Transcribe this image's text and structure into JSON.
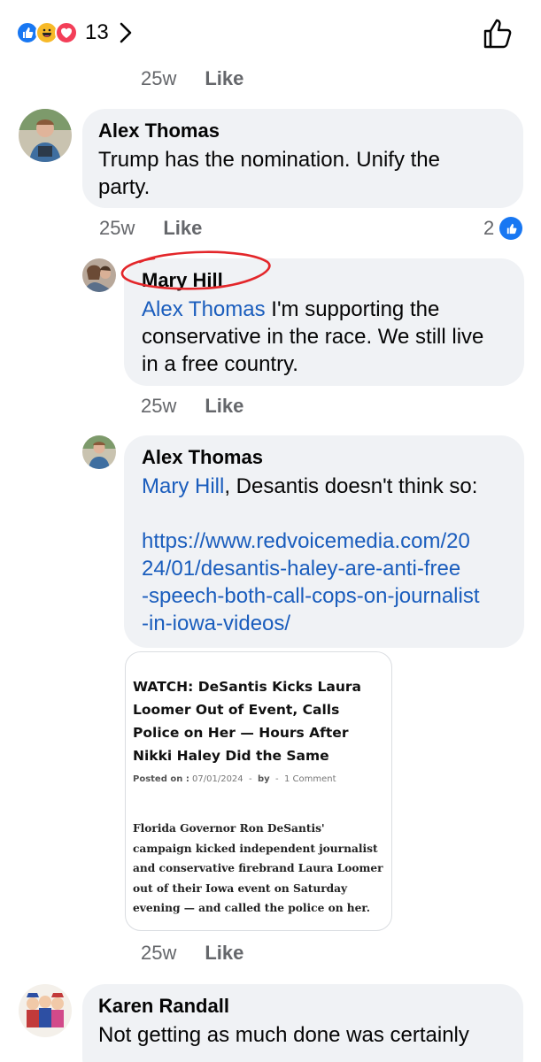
{
  "reactions": {
    "count": "13",
    "icons": [
      "like-icon",
      "haha-icon",
      "love-icon"
    ],
    "colors": {
      "like": "#1877f2",
      "haha": "#f7b928",
      "love": "#f33e58"
    }
  },
  "comments": [
    {
      "time": "25w",
      "like_label": "Like"
    },
    {
      "author": "Alex Thomas",
      "text_line1": "Trump has the nomination. Unify the",
      "text_line2": "party.",
      "time": "25w",
      "like_label": "Like",
      "reaction_count": "2"
    },
    {
      "author": "Mary Hill",
      "mention": "Alex Thomas",
      "text_line1": " I'm supporting the",
      "text_line2": "conservative in the race. We still live",
      "text_line3": "in a free country.",
      "time": "25w",
      "like_label": "Like"
    },
    {
      "author": "Alex Thomas",
      "mention": "Mary Hill",
      "text_after_mention": ", Desantis doesn't think so:",
      "link_line1": "https://www.redvoicemedia.com/20",
      "link_line2": "24/01/desantis-haley-are-anti-free",
      "link_line3": "-speech-both-call-cops-on-journalist",
      "link_line4": "-in-iowa-videos/",
      "preview": {
        "title": "WATCH: DeSantis Kicks Laura Loomer Out of Event, Calls Police on Her — Hours After Nikki Haley Did the Same",
        "posted_label": "Posted on :",
        "posted_date": "07/01/2024",
        "by_label": "by",
        "comments": "1 Comment",
        "body": "Florida Governor Ron DeSantis' campaign kicked independent journalist and conservative firebrand Laura Loomer out of their Iowa event on Saturday evening — and called the police on her."
      },
      "time": "25w",
      "like_label": "Like"
    },
    {
      "author": "Karen Randall",
      "text_line1": "Not getting as much done was certainly"
    }
  ]
}
